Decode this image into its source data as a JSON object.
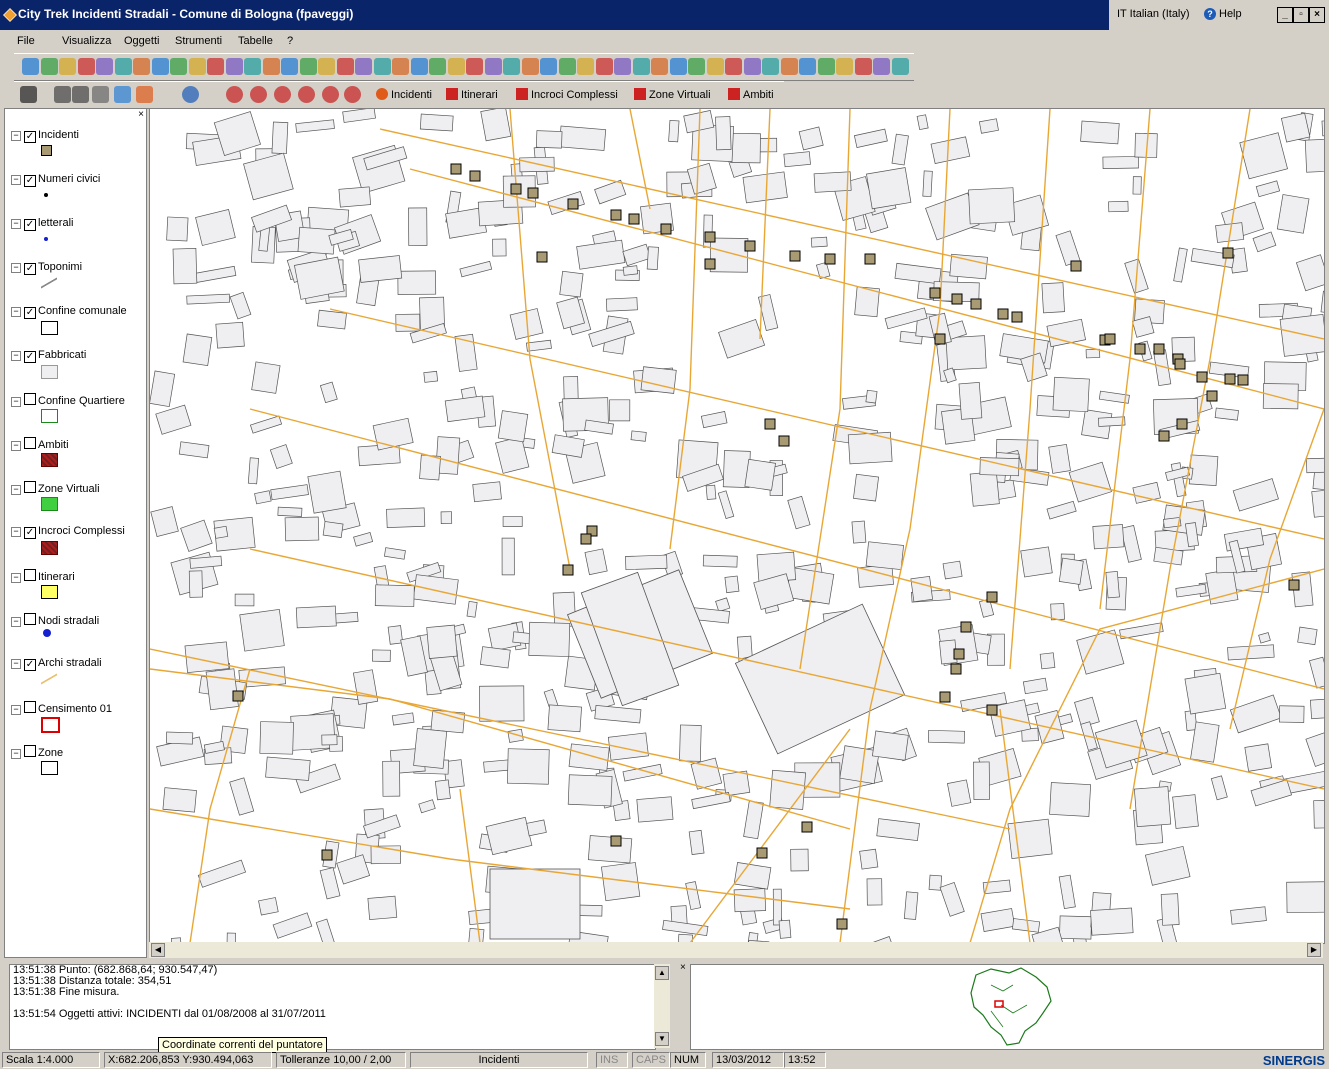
{
  "window": {
    "title": "City Trek Incidenti Stradali - Comune di Bologna (fpaveggi)",
    "language": "IT  Italian (Italy)",
    "help_label": "Help"
  },
  "menu": [
    "File",
    "Visualizza",
    "Oggetti",
    "Strumenti",
    "Tabelle",
    "?"
  ],
  "layer_buttons": [
    "Incidenti",
    "Itinerari",
    "Incroci Complessi",
    "Zone Virtuali",
    "Ambiti"
  ],
  "legend": [
    {
      "label": "Incidenti",
      "checked": true,
      "symbol": "square-tan"
    },
    {
      "label": "Numeri civici",
      "checked": true,
      "symbol": "dot-black"
    },
    {
      "label": "letterali",
      "checked": true,
      "symbol": "dot-blue"
    },
    {
      "label": "Toponimi",
      "checked": true,
      "symbol": "line-gray"
    },
    {
      "label": "Confine comunale",
      "checked": true,
      "symbol": "box-white"
    },
    {
      "label": "Fabbricati",
      "checked": true,
      "symbol": "box-lightgray"
    },
    {
      "label": "Confine Quartiere",
      "checked": false,
      "symbol": "box-green-outline"
    },
    {
      "label": "Ambiti",
      "checked": false,
      "symbol": "box-red-hatch"
    },
    {
      "label": "Zone Virtuali",
      "checked": false,
      "symbol": "box-green"
    },
    {
      "label": "Incroci Complessi",
      "checked": true,
      "symbol": "box-red-hatch"
    },
    {
      "label": "Itinerari",
      "checked": false,
      "symbol": "box-yellow"
    },
    {
      "label": "Nodi stradali",
      "checked": false,
      "symbol": "dot-blue-large"
    },
    {
      "label": "Archi stradali",
      "checked": true,
      "symbol": "line-orange"
    },
    {
      "label": "Censimento 01",
      "checked": false,
      "symbol": "box-red-outline"
    },
    {
      "label": "Zone",
      "checked": false,
      "symbol": "box-white"
    }
  ],
  "log": {
    "lines": [
      "13:51:38 Punto: (682.868,64; 930.547,47)",
      "13:51:38 Distanza totale: 354,51",
      "13:51:38 Fine misura.",
      "",
      "13:51:54 Oggetti attivi: INCIDENTI dal 01/08/2008 al 31/07/2011"
    ]
  },
  "tooltip": "Coordinate correnti del puntatore",
  "status": {
    "scale": "Scala 1:4.000",
    "coords": "X:682.206,853  Y:930.494,063",
    "tolerance": "Tolleranze 10,00 / 2,00",
    "active_layer": "Incidenti",
    "ins": "INS",
    "caps": "CAPS",
    "num": "NUM",
    "date": "13/03/2012",
    "time": "13:52",
    "brand": "SINERGIS"
  },
  "colors": {
    "titlebar": "#0a246a",
    "road": "#e8a735",
    "building_fill": "#efeef0",
    "building_stroke": "#555555",
    "incident_fill": "#a89b74"
  }
}
